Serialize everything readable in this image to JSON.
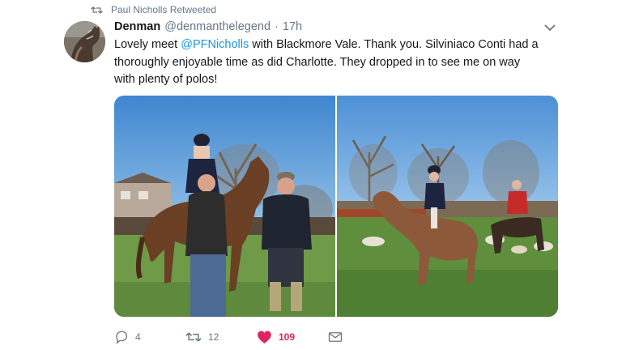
{
  "retweet_banner": {
    "text": "Paul Nicholls Retweeted",
    "icon": "retweet-icon"
  },
  "tweet": {
    "display_name": "Denman",
    "handle": "@denmanthelegend",
    "separator": "·",
    "time": "17h",
    "text": {
      "line1_before": "Lovely meet ",
      "mention": "@PFNicholls",
      "line1_after": " with Blackmore Vale. Thank you. Silviniaco Conti had a",
      "line2": "thoroughly enjoyable time as did Charlotte. They dropped in to see me on way",
      "line3": "with plenty of polos!"
    },
    "media": [
      {
        "description": "photo-1"
      },
      {
        "description": "photo-2"
      }
    ]
  },
  "actions": {
    "reply_count": "4",
    "retweet_count": "12",
    "like_count": "109",
    "reply_icon": "reply-icon",
    "retweet_icon": "retweet-icon",
    "like_icon": "heart-icon",
    "dm_icon": "envelope-icon"
  },
  "colors": {
    "link": "#1b95e0",
    "muted": "#657786",
    "like": "#e0245e",
    "text": "#14171a"
  }
}
